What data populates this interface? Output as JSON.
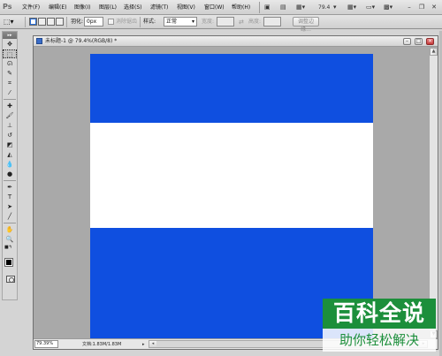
{
  "menubar": {
    "logo": "Ps",
    "items": [
      "文件(F)",
      "编辑(E)",
      "图像(I)",
      "图层(L)",
      "选择(S)",
      "滤镜(T)",
      "视图(V)",
      "窗口(W)",
      "帮助(H)"
    ],
    "zoom": "79.4"
  },
  "options": {
    "feather_label": "羽化:",
    "feather_value": "0px",
    "antialias_label": "消除锯齿",
    "style_label": "样式:",
    "style_value": "正常",
    "width_label": "宽度:",
    "height_label": "高度:",
    "refine_edge": "调整边缘..."
  },
  "tools": {
    "header": "▸▸"
  },
  "document": {
    "title": "未标题-1 @ 79.4%(RGB/8) *",
    "zoom": "79.39%",
    "info": "文档:1.83M/1.83M",
    "stripe_colors": {
      "top": "#0f4fe0",
      "middle": "#ffffff",
      "bottom": "#0f4fe0"
    }
  },
  "watermark": {
    "title": "百科全说",
    "subtitle": "助你轻松解决"
  }
}
